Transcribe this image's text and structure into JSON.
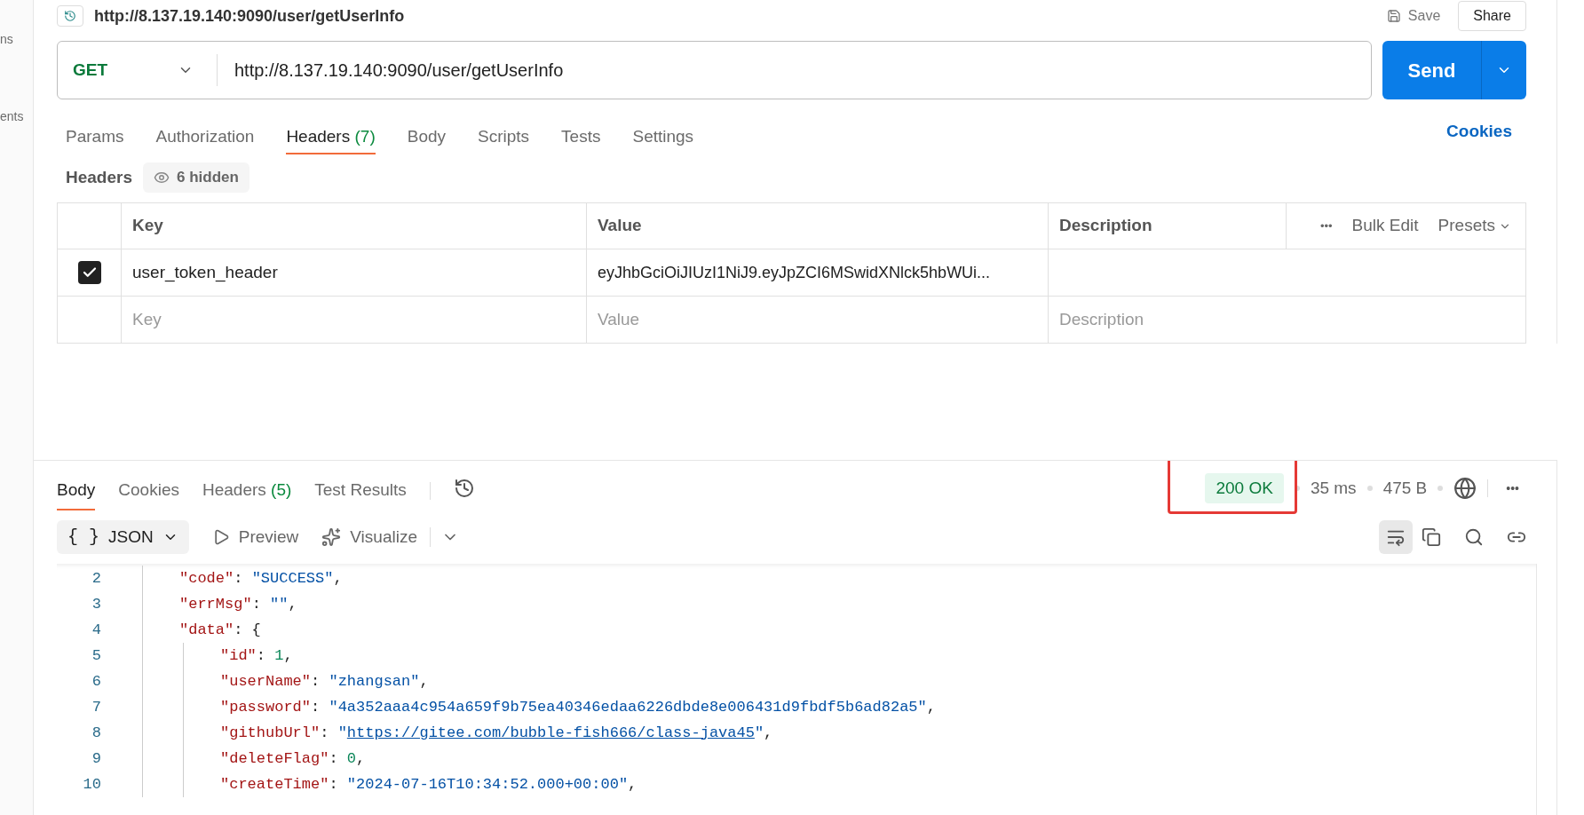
{
  "sidebar": {
    "items": [
      "ns",
      "ents"
    ]
  },
  "request": {
    "title": "http://8.137.19.140:9090/user/getUserInfo",
    "save": "Save",
    "share": "Share",
    "method": "GET",
    "url": "http://8.137.19.140:9090/user/getUserInfo",
    "send": "Send"
  },
  "request_tabs": [
    {
      "label": "Params",
      "selected": false
    },
    {
      "label": "Authorization",
      "selected": false
    },
    {
      "label": "Headers",
      "count": "(7)",
      "selected": true
    },
    {
      "label": "Body",
      "selected": false
    },
    {
      "label": "Scripts",
      "selected": false
    },
    {
      "label": "Tests",
      "selected": false
    },
    {
      "label": "Settings",
      "selected": false
    }
  ],
  "cookies_link": "Cookies",
  "headers": {
    "title": "Headers",
    "hidden": "6 hidden",
    "columns": [
      "Key",
      "Value",
      "Description"
    ],
    "actions": {
      "more": "•••",
      "bulk_edit": "Bulk Edit",
      "presets": "Presets"
    },
    "rows": [
      {
        "checked": true,
        "key": "user_token_header",
        "value": "eyJhbGciOiJIUzI1NiJ9.eyJpZCI6MSwidXNlck5hbWUi..."
      }
    ],
    "placeholders": {
      "key": "Key",
      "value": "Value",
      "description": "Description"
    }
  },
  "response": {
    "tabs": [
      {
        "label": "Body",
        "selected": true
      },
      {
        "label": "Cookies",
        "selected": false
      },
      {
        "label": "Headers",
        "count": "(5)",
        "selected": false
      },
      {
        "label": "Test Results",
        "selected": false
      }
    ],
    "status": "200 OK",
    "time": "35 ms",
    "size": "475 B",
    "more": "•••",
    "format": "JSON",
    "format_icon": "{ }",
    "preview": "Preview",
    "visualize": "Visualize",
    "lines": [
      {
        "number": "2",
        "tokens": [
          {
            "kind": "key",
            "text": "\"code\""
          },
          {
            "kind": "punct",
            "text": ": "
          },
          {
            "kind": "string",
            "text": "\"SUCCESS\""
          },
          {
            "kind": "punct",
            "text": ","
          }
        ]
      },
      {
        "number": "3",
        "tokens": [
          {
            "kind": "key",
            "text": "\"errMsg\""
          },
          {
            "kind": "punct",
            "text": ": "
          },
          {
            "kind": "string",
            "text": "\"\""
          },
          {
            "kind": "punct",
            "text": ","
          }
        ]
      },
      {
        "number": "4",
        "tokens": [
          {
            "kind": "key",
            "text": "\"data\""
          },
          {
            "kind": "punct",
            "text": ": {"
          }
        ],
        "children": [
          {
            "number": "5",
            "tokens": [
              {
                "kind": "key",
                "text": "\"id\""
              },
              {
                "kind": "punct",
                "text": ": "
              },
              {
                "kind": "number",
                "text": "1"
              },
              {
                "kind": "punct",
                "text": ","
              }
            ]
          },
          {
            "number": "6",
            "tokens": [
              {
                "kind": "key",
                "text": "\"userName\""
              },
              {
                "kind": "punct",
                "text": ": "
              },
              {
                "kind": "string",
                "text": "\"zhangsan\""
              },
              {
                "kind": "punct",
                "text": ","
              }
            ]
          },
          {
            "number": "7",
            "tokens": [
              {
                "kind": "key",
                "text": "\"password\""
              },
              {
                "kind": "punct",
                "text": ": "
              },
              {
                "kind": "string",
                "text": "\"4a352aaa4c954a659f9b75ea40346edaa6226dbde8e006431d9fbdf5b6ad82a5\""
              },
              {
                "kind": "punct",
                "text": ","
              }
            ]
          },
          {
            "number": "8",
            "tokens": [
              {
                "kind": "key",
                "text": "\"githubUrl\""
              },
              {
                "kind": "punct",
                "text": ": "
              },
              {
                "kind": "string",
                "text": "\""
              },
              {
                "kind": "link",
                "text": "https://gitee.com/bubble-fish666/class-java45"
              },
              {
                "kind": "string",
                "text": "\""
              },
              {
                "kind": "punct",
                "text": ","
              }
            ]
          },
          {
            "number": "9",
            "tokens": [
              {
                "kind": "key",
                "text": "\"deleteFlag\""
              },
              {
                "kind": "punct",
                "text": ": "
              },
              {
                "kind": "number",
                "text": "0"
              },
              {
                "kind": "punct",
                "text": ","
              }
            ]
          },
          {
            "number": "10",
            "tokens": [
              {
                "kind": "key",
                "text": "\"createTime\""
              },
              {
                "kind": "punct",
                "text": ": "
              },
              {
                "kind": "string",
                "text": "\"2024-07-16T10:34:52.000+00:00\""
              },
              {
                "kind": "punct",
                "text": ","
              }
            ]
          }
        ]
      }
    ]
  }
}
